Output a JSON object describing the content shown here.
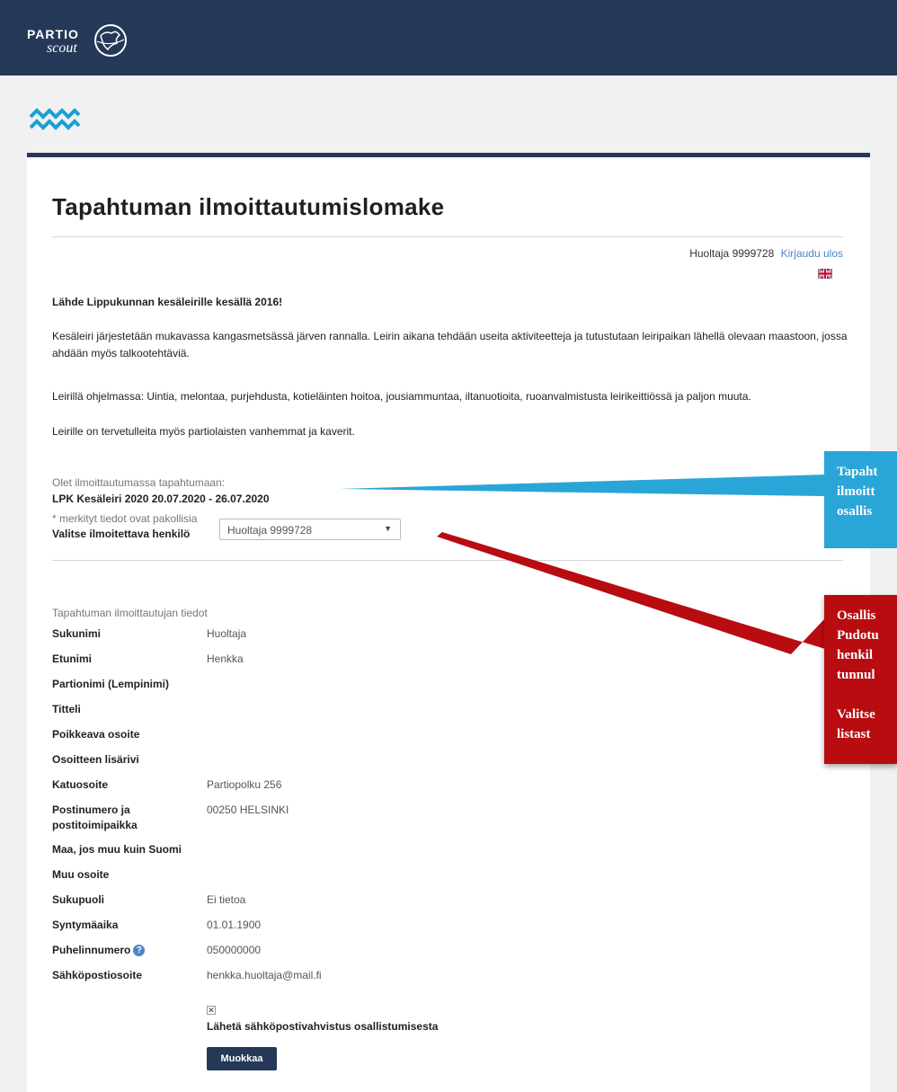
{
  "header": {
    "brand_top": "PARTIO",
    "brand_bottom": "scout"
  },
  "page": {
    "title": "Tapahtuman ilmoittautumislomake"
  },
  "user": {
    "name": "Huoltaja 9999728",
    "logout_label": "Kirjaudu ulos"
  },
  "intro": {
    "heading": "Lähde Lippukunnan kesäleirille kesällä 2016!",
    "paragraph1": "Kesäleiri järjestetään mukavassa kangasmetsässä järven rannalla. Leirin aikana tehdään useita aktiviteetteja ja tutustutaan leiripaikan lähellä olevaan maastoon, jossa ahdään myös talkootehtäviä.",
    "paragraph2": "Leirillä ohjelmassa: Uintia, melontaa, purjehdusta, kotieläinten hoitoa, jousiammuntaa, iltanuotioita, ruoanvalmistusta leirikeittiössä ja paljon muuta.",
    "paragraph3": "Leirille on tervetulleita myös partiolaisten vanhemmat ja kaverit."
  },
  "event": {
    "registering_label": "Olet ilmoittautumassa tapahtumaan:",
    "name": "LPK Kesäleiri 2020 20.07.2020 - 26.07.2020",
    "required_note": "* merkityt tiedot ovat pakollisia"
  },
  "person_select": {
    "label": "Valitse ilmoitettava henkilö",
    "selected": "Huoltaja 9999728"
  },
  "registrant": {
    "section_label": "Tapahtuman ilmoittautujan tiedot",
    "fields": [
      {
        "label": "Sukunimi",
        "value": "Huoltaja"
      },
      {
        "label": "Etunimi",
        "value": "Henkka"
      },
      {
        "label": "Partionimi (Lempinimi)",
        "value": ""
      },
      {
        "label": "Titteli",
        "value": ""
      },
      {
        "label": "Poikkeava osoite",
        "value": ""
      },
      {
        "label": "Osoitteen lisärivi",
        "value": ""
      },
      {
        "label": "Katuosoite",
        "value": "Partiopolku 256"
      },
      {
        "label": "Postinumero ja postitoimipaikka",
        "value": "00250 HELSINKI"
      },
      {
        "label": "Maa, jos muu kuin Suomi",
        "value": ""
      },
      {
        "label": "Muu osoite",
        "value": ""
      },
      {
        "label": "Sukupuoli",
        "value": "Ei tietoa"
      },
      {
        "label": "Syntymäaika",
        "value": "01.01.1900"
      },
      {
        "label": "Puhelinnumero",
        "value": "050000000"
      },
      {
        "label": "Sähköpostiosoite",
        "value": "henkka.huoltaja@mail.fi"
      }
    ],
    "help_glyph": "?",
    "checkbox_mark": "✕",
    "checkbox_label": "Lähetä sähköpostivahvistus osallistumisesta",
    "edit_button": "Muokkaa"
  },
  "callouts": {
    "blue": [
      "Tapaht",
      "ilmoitt",
      "osallis"
    ],
    "red": [
      "Osallis",
      "Pudotu",
      "henkil",
      "tunnul",
      "",
      "Valitse",
      "listast"
    ]
  },
  "colors": {
    "header_bg": "#253858",
    "link": "#4b86c6",
    "callout_blue": "#2aa5d8",
    "callout_red": "#b80c11"
  },
  "icons": {
    "logo": "globe-icon",
    "wave": "wave-logo-icon",
    "flag": "uk-flag-icon",
    "help": "help-icon",
    "dropdown": "chevron-down-icon"
  }
}
